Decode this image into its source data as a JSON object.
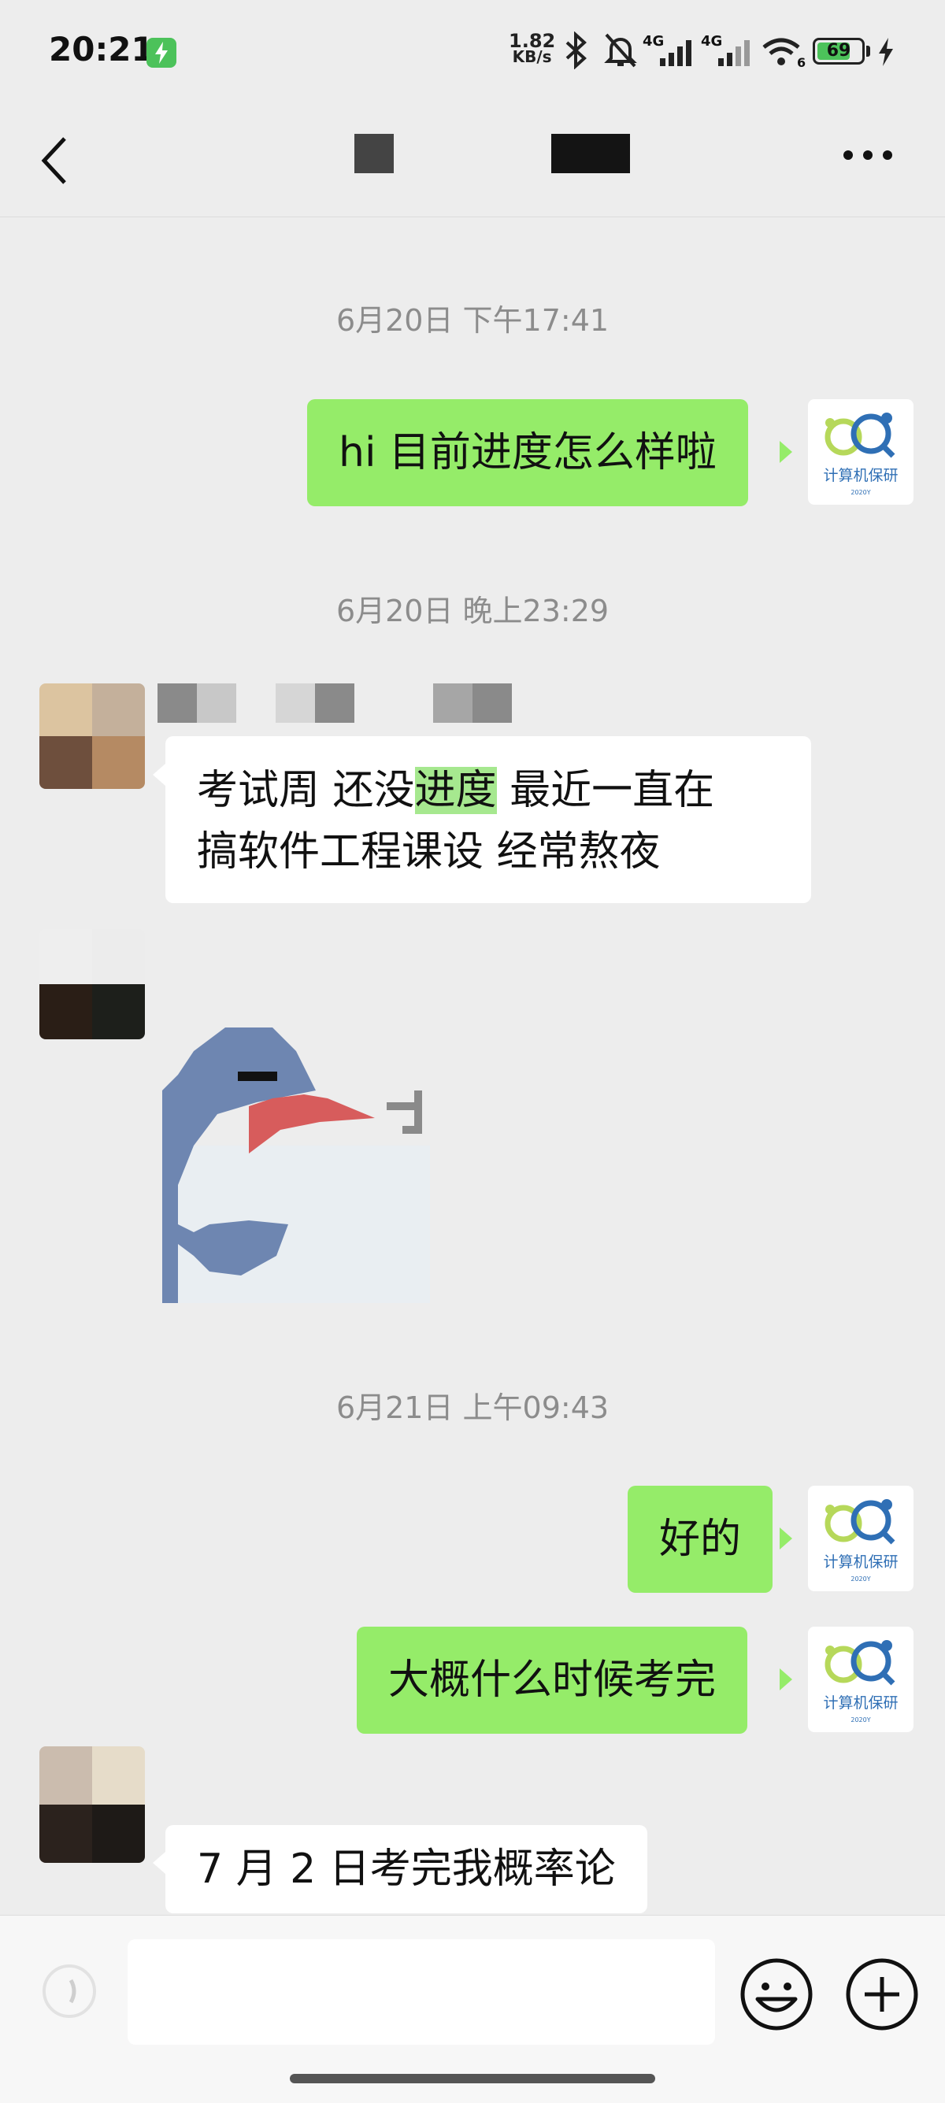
{
  "status_bar": {
    "time": "20:21",
    "net_speed_value": "1.82",
    "net_speed_unit": "KB/s",
    "signal_1": "4G",
    "signal_2": "4G",
    "wifi_badge": "6",
    "battery": "69",
    "icons": [
      "charging-badge-icon",
      "bluetooth-icon",
      "mute-icon",
      "signal-icon",
      "signal-icon",
      "wifi-icon",
      "battery-icon",
      "bolt-icon"
    ]
  },
  "nav": {
    "icons": [
      "back-arrow-icon",
      "more-icon"
    ]
  },
  "messages": [
    {
      "type": "timestamp",
      "text": "6月20日 下午17:41"
    },
    {
      "type": "sent",
      "text": "hi 目前进度怎么样啦"
    },
    {
      "type": "timestamp",
      "text": "6月20日 晚上23:29"
    },
    {
      "type": "received",
      "line1_a": "考试周 还没",
      "line1_hl": "进度",
      "line1_b": " 最近一直在",
      "line2": "搞软件工程课设 经常熬夜"
    },
    {
      "type": "sticker",
      "icon": "pixel-dolphin-sticker"
    },
    {
      "type": "timestamp",
      "text": "6月21日 上午09:43"
    },
    {
      "type": "sent",
      "text": "好的"
    },
    {
      "type": "sent",
      "text": "大概什么时候考完"
    },
    {
      "type": "received",
      "text": "7 月 2 日考完我概率论"
    }
  ],
  "my_avatar": {
    "label": "计算机保研",
    "sub": "2020Y"
  },
  "input_bar": {
    "placeholder": "",
    "icons": [
      "voice-icon",
      "emoji-icon",
      "plus-icon"
    ]
  },
  "colors": {
    "sent_bubble": "#95ec69",
    "received_bubble": "#ffffff",
    "background": "#ededed",
    "highlight": "#a6e88f"
  }
}
